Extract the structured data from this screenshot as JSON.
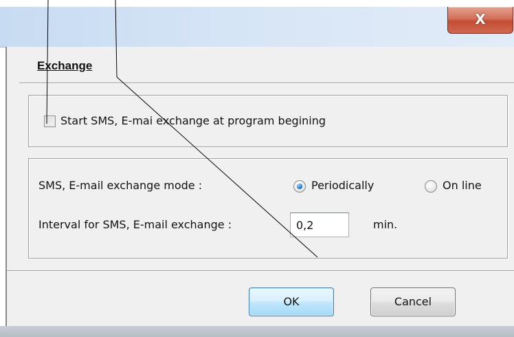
{
  "window": {
    "close_glyph": "X"
  },
  "dialog": {
    "section_title": "Exchange",
    "start_group": {
      "checkbox_label": "Start SMS, E-mai exchange at program begining",
      "checked": false
    },
    "mode_group": {
      "mode_label": "SMS, E-mail exchange mode :",
      "options": [
        "Periodically",
        "On line"
      ],
      "selected": "Periodically",
      "interval_label": "Interval for SMS, E-mail exchange :",
      "interval_value": "0,2",
      "interval_unit": "min."
    },
    "buttons": {
      "ok": "OK",
      "cancel": "Cancel"
    }
  },
  "colors": {
    "dialog_bg": "#f0f0f0",
    "titlebar_bg": "#d6e5f6",
    "close_button": "#c34d33",
    "ok_border": "#3c7fb1",
    "radio_selected": "#2a7fd1"
  },
  "icons": {
    "close": "close-icon"
  }
}
